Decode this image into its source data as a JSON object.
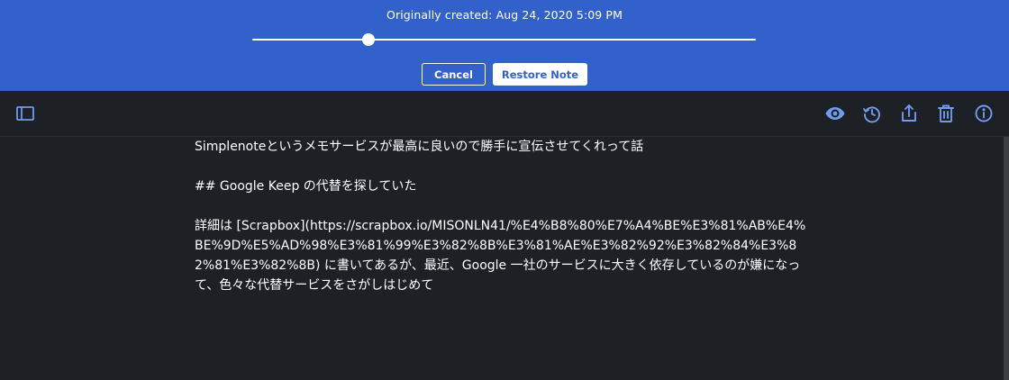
{
  "revision": {
    "created_label": "Originally created: Aug 24, 2020 5:09 PM",
    "slider_value": 0.23,
    "cancel_label": "Cancel",
    "restore_label": "Restore Note"
  },
  "toolbar": {
    "sidebar_toggle_icon": "sidebar-icon",
    "preview_icon": "eye-icon",
    "history_icon": "history-icon",
    "share_icon": "share-icon",
    "trash_icon": "trash-icon",
    "info_icon": "info-icon"
  },
  "colors": {
    "accent": "#3361cc",
    "editor_bg": "#1d2125",
    "icon": "#6f9bf0",
    "text": "#ffffff"
  },
  "note": {
    "paragraphs": [
      "Simplenoteというメモサービスが最高に良いので勝手に宣伝させてくれって話",
      "## Google Keep の代替を探していた",
      "詳細は [Scrapbox](https://scrapbox.io/MISONLN41/%E4%B8%80%E7%A4%BE%E3%81%AB%E4%BE%9D%E5%AD%98%E3%81%99%E3%82%8B%E3%81%AE%E3%82%92%E3%82%84%E3%82%81%E3%82%8B) に書いてあるが、最近、Google 一社のサービスに大きく依存しているのが嫌になって、色々な代替サービスをさがしはじめて"
    ]
  }
}
